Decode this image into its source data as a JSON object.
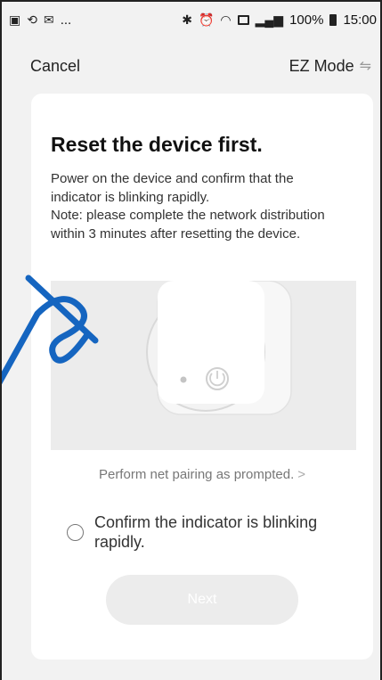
{
  "status_bar": {
    "left_icons": [
      "image-icon",
      "sync-icon",
      "mail-icon"
    ],
    "left_more": "...",
    "right_icons": [
      "bluetooth-icon",
      "alarm-icon",
      "wifi-icon",
      "data-icon",
      "signal-icon"
    ],
    "battery": "100%",
    "time": "15:00"
  },
  "topbar": {
    "cancel_label": "Cancel",
    "mode_label": "EZ Mode",
    "mode_icon": "switch-icon"
  },
  "card": {
    "title": "Reset the device first.",
    "description": [
      "Power on the device and confirm that the indicator is blinking rapidly.",
      "Note: please complete the network distribution within 3 minutes after resetting the device."
    ],
    "prompt_link": "Perform net pairing as prompted.",
    "prompt_chevron": ">",
    "confirm_label": "Confirm the indicator is blinking rapidly.",
    "next_label": "Next"
  },
  "colors": {
    "page_bg": "#f2f2f2",
    "card_bg": "#ffffff",
    "illustration_bg": "#ececec",
    "button_disabled_bg": "#ececec",
    "watermark": "#1565c0"
  }
}
